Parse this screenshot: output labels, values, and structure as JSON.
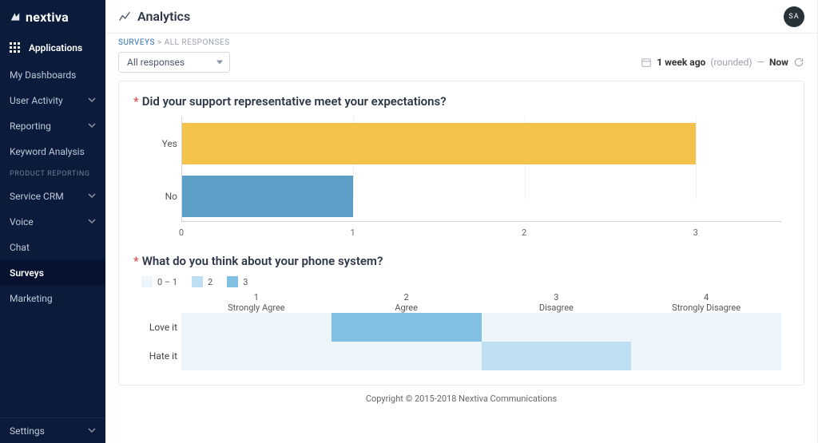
{
  "brand": "nextiva",
  "page_title": "Analytics",
  "avatar": "SA",
  "sidebar": {
    "apps_label": "Applications",
    "items": [
      {
        "label": "My Dashboards"
      },
      {
        "label": "User Activity"
      },
      {
        "label": "Reporting"
      },
      {
        "label": "Keyword Analysis"
      }
    ],
    "section_label": "PRODUCT REPORTING",
    "product_items": [
      {
        "label": "Service CRM"
      },
      {
        "label": "Voice"
      },
      {
        "label": "Chat"
      },
      {
        "label": "Surveys"
      },
      {
        "label": "Marketing"
      }
    ],
    "settings_label": "Settings"
  },
  "breadcrumb": {
    "root": "SURVEYS",
    "sep": ">",
    "current": "ALL RESPONSES"
  },
  "filter": {
    "dropdown_value": "All responses"
  },
  "range": {
    "start": "1 week ago",
    "qualifier": "(rounded)",
    "dash": "—",
    "end": "Now"
  },
  "questions": {
    "q1": {
      "text": "Did your support representative meet your expectations?"
    },
    "q2": {
      "text": "What do you think about your phone system?"
    }
  },
  "chart_data": [
    {
      "type": "bar",
      "orientation": "horizontal",
      "title": "Did your support representative meet your expectations?",
      "xlabel": "",
      "ylabel": "",
      "categories": [
        "Yes",
        "No"
      ],
      "values": [
        3,
        1
      ],
      "xlim": [
        0,
        3.5
      ],
      "xticks": [
        0,
        1,
        2,
        3
      ],
      "colors": {
        "Yes": "#f3c24b",
        "No": "#5b9fc6"
      }
    },
    {
      "type": "heatmap",
      "title": "What do you think about your phone system?",
      "legend": [
        "0 – 1",
        "2",
        "3"
      ],
      "x_categories": [
        {
          "num": "1",
          "label": "Strongly Agree"
        },
        {
          "num": "2",
          "label": "Agree"
        },
        {
          "num": "3",
          "label": "Disagree"
        },
        {
          "num": "4",
          "label": "Strongly Disagree"
        }
      ],
      "y_categories": [
        "Love it",
        "Hate it"
      ],
      "z": [
        [
          0,
          3,
          0,
          0
        ],
        [
          0,
          0,
          2,
          0
        ]
      ],
      "color_scale": {
        "0": "#edf5fb",
        "1": "#edf5fb",
        "2": "#bddff1",
        "3": "#81c0e2"
      }
    }
  ],
  "footer": "Copyright © 2015-2018 Nextiva Communications"
}
